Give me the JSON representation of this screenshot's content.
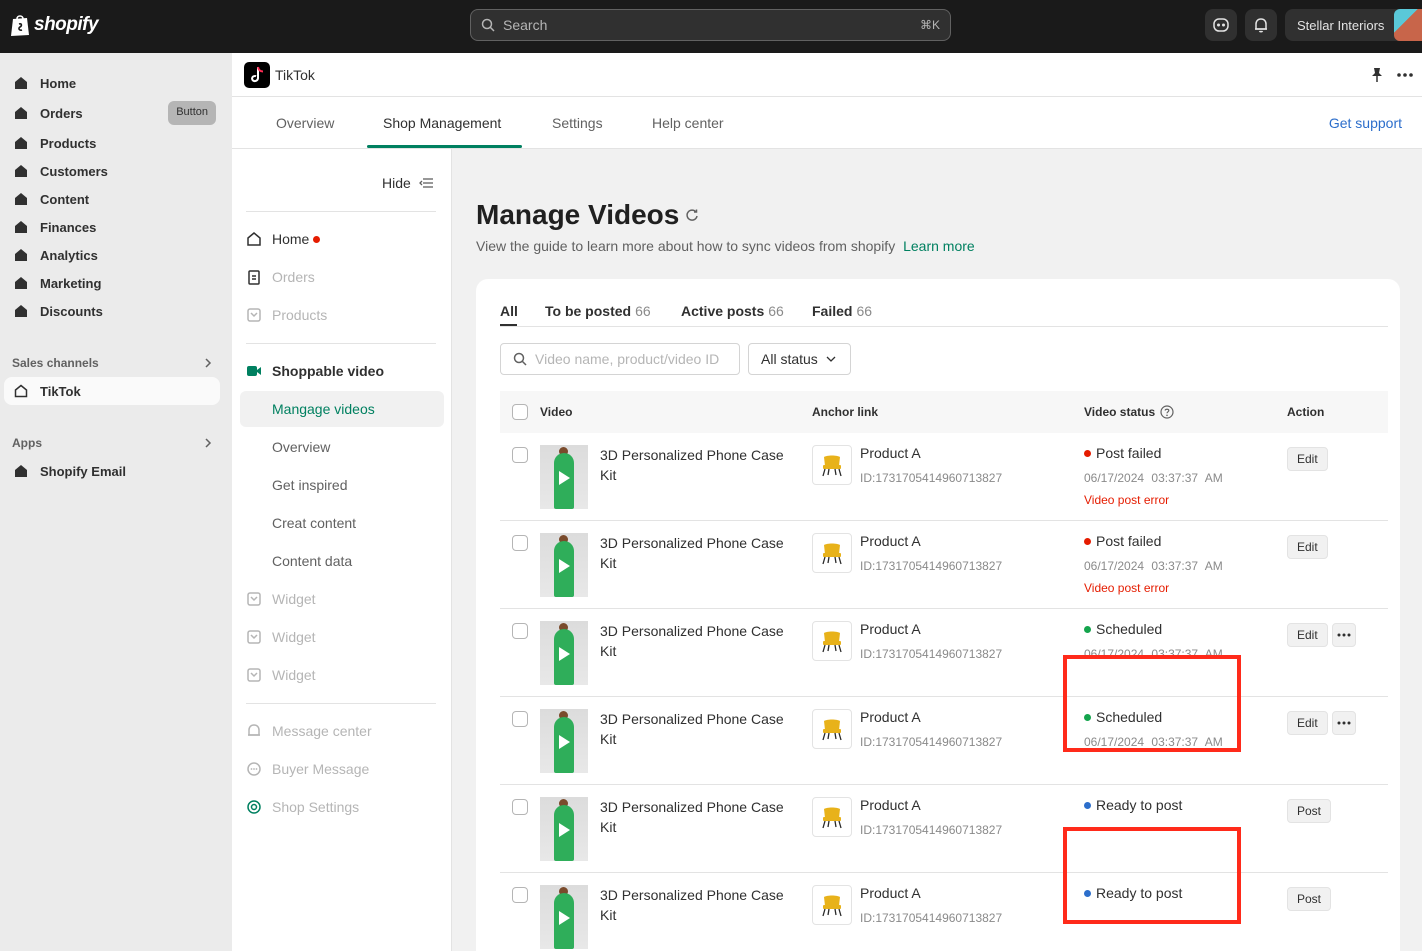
{
  "brand": {
    "name": "shopify"
  },
  "search": {
    "placeholder": "Search",
    "shortcut": "⌘K"
  },
  "store": {
    "name": "Stellar Interiors"
  },
  "nav": {
    "items": [
      {
        "label": "Home"
      },
      {
        "label": "Orders",
        "badge": "Button"
      },
      {
        "label": "Products"
      },
      {
        "label": "Customers"
      },
      {
        "label": "Content"
      },
      {
        "label": "Finances"
      },
      {
        "label": "Analytics"
      },
      {
        "label": "Marketing"
      },
      {
        "label": "Discounts"
      }
    ],
    "sales_channels_label": "Sales channels",
    "channel": {
      "label": "TikTok"
    },
    "apps_label": "Apps",
    "app": {
      "label": "Shopify Email"
    }
  },
  "app": {
    "title": "TikTok",
    "tabs": [
      {
        "label": "Overview"
      },
      {
        "label": "Shop Management"
      },
      {
        "label": "Settings"
      },
      {
        "label": "Help center"
      }
    ],
    "get_support": "Get support"
  },
  "subnav": {
    "hide_label": "Hide",
    "items": {
      "home": "Home",
      "orders": "Orders",
      "products": "Products",
      "shoppable_video": "Shoppable video",
      "manage_videos": "Mangage videos",
      "overview": "Overview",
      "get_inspired": "Get inspired",
      "creat_content": "Creat content",
      "content_data": "Content data",
      "widget1": "Widget",
      "widget2": "Widget",
      "widget3": "Widget",
      "message_center": "Message center",
      "buyer_message": "Buyer Message",
      "shop_settings": "Shop Settings"
    }
  },
  "page": {
    "title": "Manage Videos",
    "description": "View the guide to learn more about how to sync videos from shopify",
    "learn_more": "Learn more"
  },
  "video_tabs": [
    {
      "label": "All",
      "count": ""
    },
    {
      "label": "To be posted",
      "count": "66"
    },
    {
      "label": "Active posts",
      "count": "66"
    },
    {
      "label": "Failed",
      "count": "66"
    }
  ],
  "filters": {
    "search_placeholder": "Video name, product/video ID",
    "status": "All status"
  },
  "table": {
    "headers": {
      "video": "Video",
      "anchor": "Anchor link",
      "status": "Video status",
      "action": "Action"
    },
    "rows": [
      {
        "video": "3D Personalized Phone Case Kit",
        "product": "Product A",
        "product_id": "ID:1731705414960713827",
        "status": "Post failed",
        "status_color": "#e51c00",
        "date": "06/17/2024 03:37:37 AM",
        "error": "Video post error",
        "action": "Edit",
        "more": false
      },
      {
        "video": "3D Personalized Phone Case Kit",
        "product": "Product A",
        "product_id": "ID:1731705414960713827",
        "status": "Post failed",
        "status_color": "#e51c00",
        "date": "06/17/2024 03:37:37 AM",
        "error": "Video post error",
        "action": "Edit",
        "more": false
      },
      {
        "video": "3D Personalized Phone Case Kit",
        "product": "Product A",
        "product_id": "ID:1731705414960713827",
        "status": "Scheduled",
        "status_color": "#14a44d",
        "date": "06/17/2024 03:37:37 AM",
        "error": "",
        "action": "Edit",
        "more": true
      },
      {
        "video": "3D Personalized Phone Case Kit",
        "product": "Product A",
        "product_id": "ID:1731705414960713827",
        "status": "Scheduled",
        "status_color": "#14a44d",
        "date": "06/17/2024 03:37:37 AM",
        "error": "",
        "action": "Edit",
        "more": true
      },
      {
        "video": "3D Personalized Phone Case Kit",
        "product": "Product A",
        "product_id": "ID:1731705414960713827",
        "status": "Ready to post",
        "status_color": "#2c6ecb",
        "date": "",
        "error": "",
        "action": "Post",
        "more": false
      },
      {
        "video": "3D Personalized Phone Case Kit",
        "product": "Product A",
        "product_id": "ID:1731705414960713827",
        "status": "Ready to post",
        "status_color": "#2c6ecb",
        "date": "",
        "error": "",
        "action": "Post",
        "more": false
      }
    ]
  },
  "colors": {
    "accent": "#008060",
    "highlight": "#ff2a1a",
    "link": "#2c6ecb"
  }
}
